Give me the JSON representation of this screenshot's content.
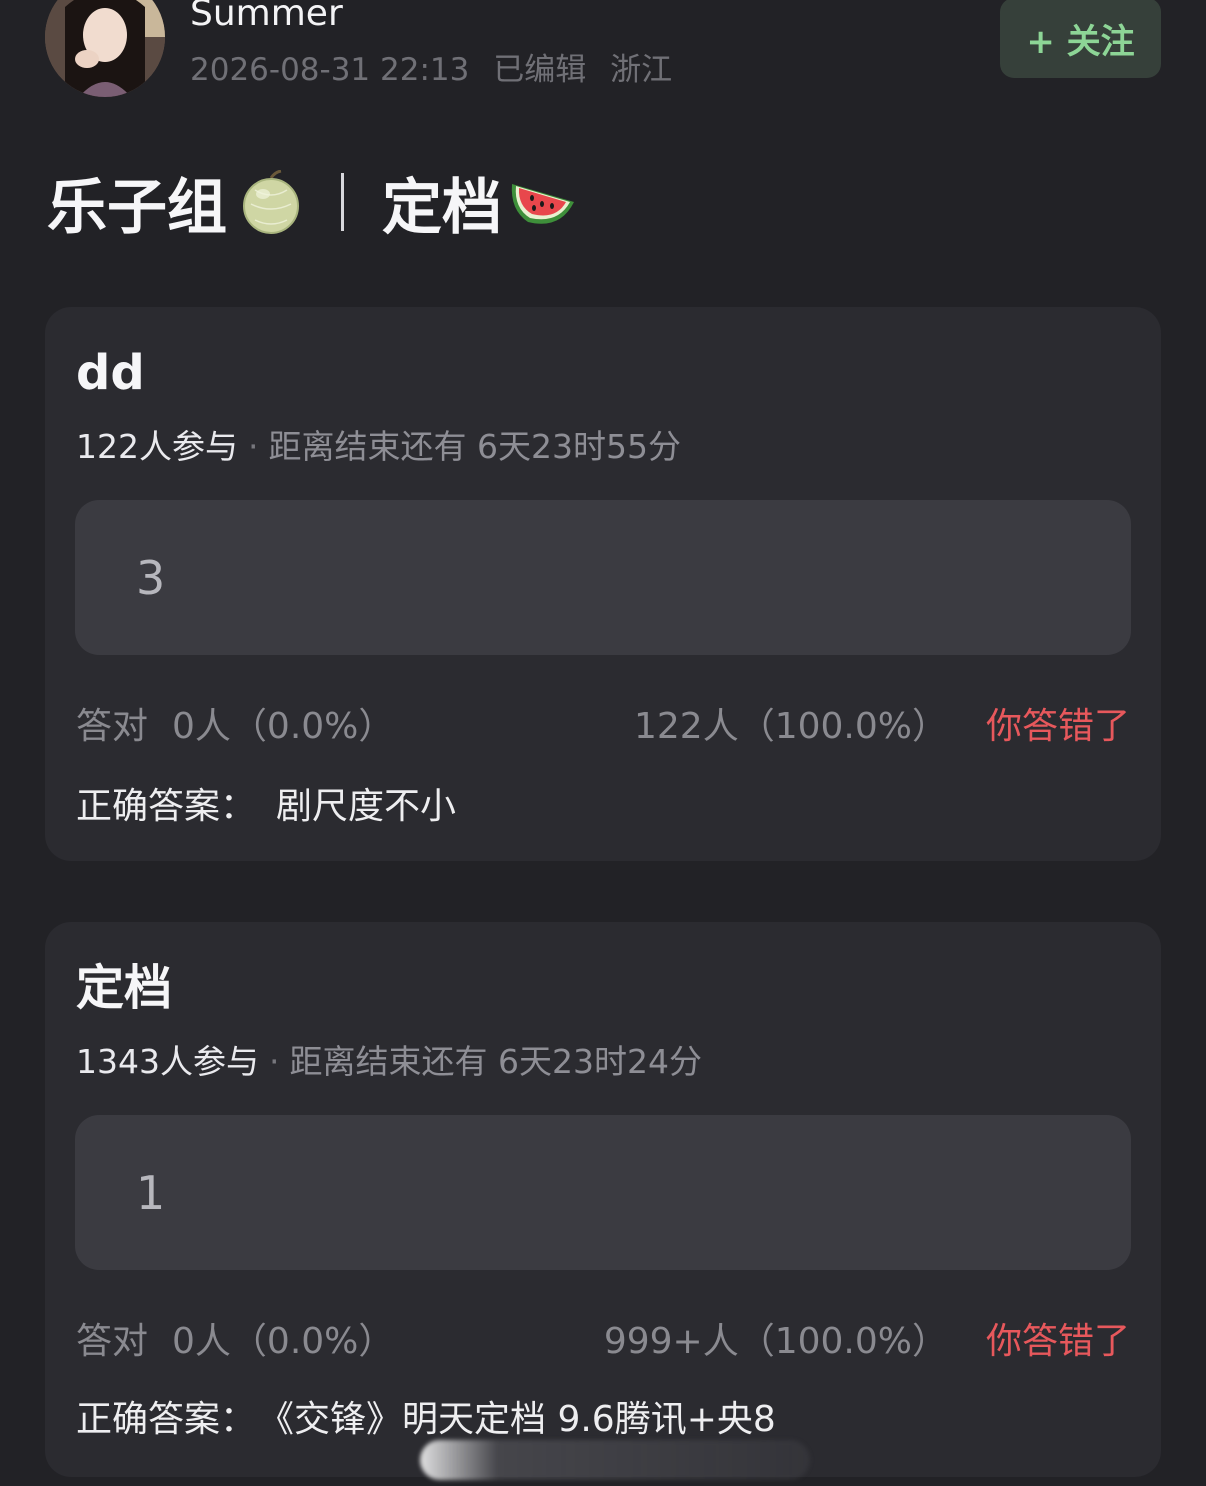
{
  "header": {
    "username": "Summer",
    "timestamp": "2026-08-31 22:13",
    "edited": "已编辑",
    "location": "浙江",
    "follow_label": "+ 关注"
  },
  "post": {
    "title_part1": "乐子组",
    "title_part2": "定档"
  },
  "quizzes": [
    {
      "title": "dd",
      "participants": "122人参与",
      "countdown": "距离结束还有 6天23时55分",
      "option": "3",
      "correct_label": "答对",
      "correct_stat": "0人（0.0%）",
      "wrong_stat": "122人（100.0%）",
      "verdict": "你答错了",
      "answer_label": "正确答案：",
      "answer": "剧尺度不小"
    },
    {
      "title": "定档",
      "participants": "1343人参与",
      "countdown": "距离结束还有 6天23时24分",
      "option": "1",
      "correct_label": "答对",
      "correct_stat": "0人（0.0%）",
      "wrong_stat": "999+人（100.0%）",
      "verdict": "你答错了",
      "answer_label": "正确答案：",
      "answer": "《交锋》明天定档 9.6腾讯+央8"
    }
  ],
  "colors": {
    "background": "#222226",
    "card": "#2b2b30",
    "option": "#3b3b41",
    "follow_text": "#8dd596",
    "verdict": "#e7585c"
  },
  "icons": {
    "title_emoji_1": "melon-icon",
    "title_emoji_2": "watermelon-icon"
  }
}
